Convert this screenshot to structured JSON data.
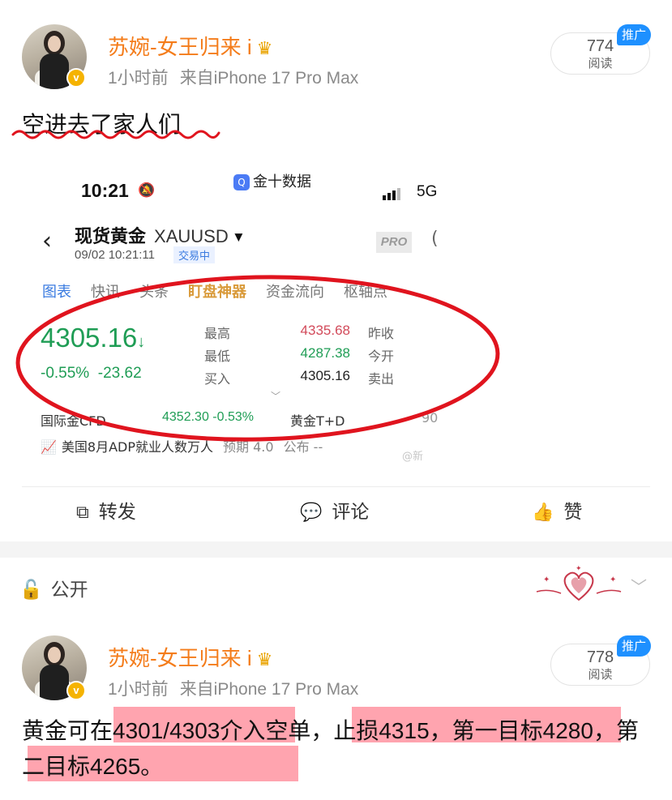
{
  "post1": {
    "username": "苏婉-女王归来 i",
    "time": "1小时前",
    "source": "来自iPhone 17 Pro Max",
    "read_count": "774",
    "read_label": "阅读",
    "promo_badge": "推广",
    "verified_badge": "v",
    "text": "空进去了家人们",
    "screenshot": {
      "status_time": "10:21",
      "app_name": "金十数据",
      "network": "5G",
      "instrument": "现货黄金",
      "code": "XAUUSD",
      "pro": "PRO",
      "datetime": "09/02 10:21:11",
      "status": "交易中",
      "tabs": [
        "图表",
        "快讯",
        "头条",
        "盯盘神器",
        "资金流向",
        "枢轴点"
      ],
      "price": "4305.16",
      "change_pct": "-0.55%",
      "change": "-23.62",
      "quote_labels": [
        "最高",
        "最低",
        "买入"
      ],
      "quote_values": [
        "4335.68",
        "4287.38",
        "4305.16"
      ],
      "quote_labels2": [
        "昨收",
        "今开",
        "卖出"
      ],
      "cfd_label": "国际金CFD",
      "cfd_value": "4352.30 -0.53%",
      "td_label": "黄金T+D",
      "td_value": "90",
      "adp_text": "美国8月ADP就业人数万人",
      "adp_forecast": "预期 4.0",
      "adp_actual": "公布 --",
      "watermark": "@新"
    },
    "actions": {
      "repost": "转发",
      "comment": "评论",
      "like": "赞"
    }
  },
  "visibility": {
    "label": "公开"
  },
  "post2": {
    "username": "苏婉-女王归来 i",
    "time": "1小时前",
    "source": "来自iPhone 17 Pro Max",
    "read_count": "778",
    "read_label": "阅读",
    "promo_badge": "推广",
    "verified_badge": "v",
    "text": "黄金可在4301/4303介入空单，止损4315，第一目标4280，第二目标4265。"
  },
  "colors": {
    "username": "#f47c1a",
    "promo": "#1e90ff",
    "rise_fall_green": "#1f9d55",
    "annotation_red": "#e0141e",
    "highlight_pink": "#ff5a6e"
  }
}
